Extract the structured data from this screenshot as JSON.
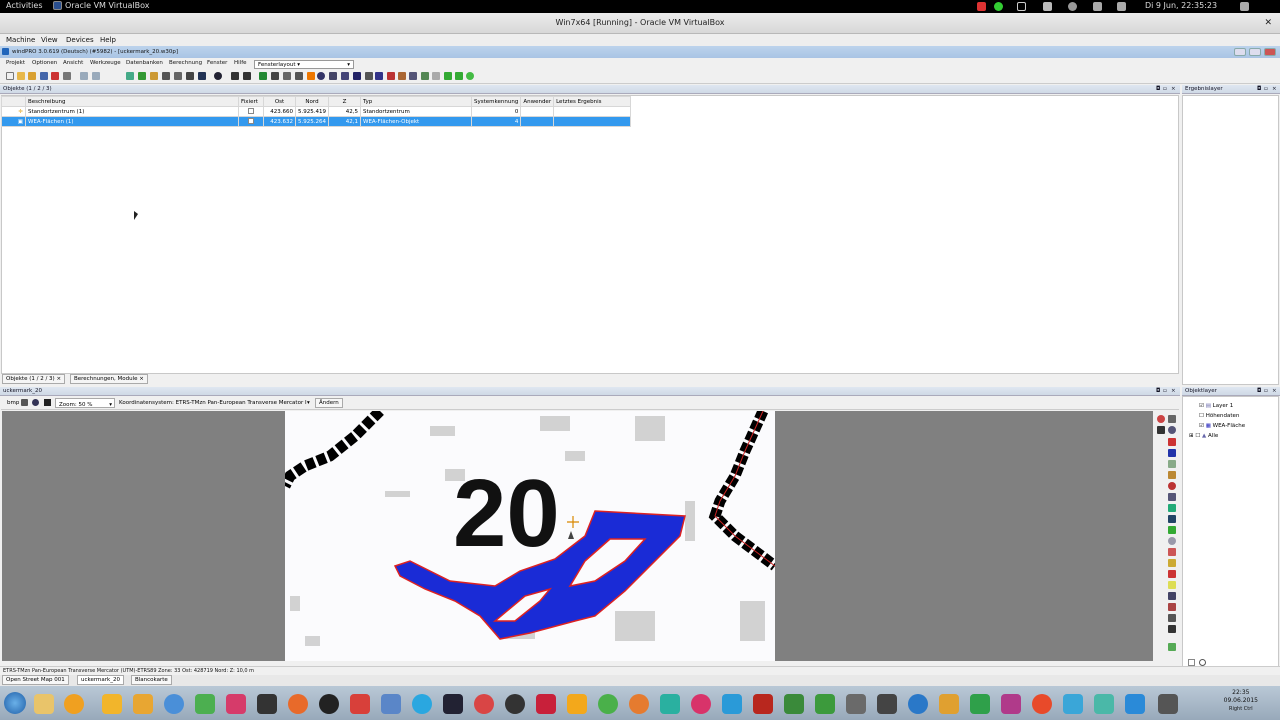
{
  "gnome": {
    "activities": "Activities",
    "app": "Oracle VM VirtualBox",
    "datetime": "Di 9 Jun, 22:35:23"
  },
  "vbox": {
    "title": "Win7x64 [Running] - Oracle VM VirtualBox",
    "menu": [
      "Machine",
      "View",
      "Devices",
      "Help"
    ]
  },
  "windpro": {
    "title": "windPRO 3.0.619 (Deutsch) (#5982) - [uckermark_20.w30p]",
    "menu": [
      "Projekt",
      "Optionen",
      "Ansicht",
      "Werkzeuge",
      "Datenbanken",
      "Berechnung",
      "Fenster",
      "Hilfe"
    ],
    "layout_combo": "Fensterlayout",
    "objects_panel_title": "Objekte (1 / 2 / 3)",
    "results_panel_title": "Ergebnislayer",
    "table": {
      "headers": [
        "Beschreibung",
        "Fixiert",
        "Ost",
        "Nord",
        "Z",
        "Typ",
        "Systemkennung",
        "Anwender",
        "Letztes Ergebnis"
      ],
      "rows": [
        {
          "desc": "Standortzentrum (1)",
          "ost": "423.660",
          "nord": "5.925.419",
          "z": "42,5",
          "typ": "Standortzentrum",
          "sys": "0"
        },
        {
          "desc": "WEA-Flächen (1)",
          "ost": "423.632",
          "nord": "5.925.264",
          "z": "42,1",
          "typ": "WEA-Flächen-Objekt",
          "sys": "4"
        }
      ]
    },
    "bottom_tabs": [
      "Objekte (1 / 2 / 3)",
      "Berechnungen, Module"
    ],
    "map_panel_title": "uckermark_20",
    "map_toolbar": {
      "bmp": "bmp",
      "zoom": "Zoom: 50 %",
      "koord": "Koordinatensystem: ETRS-TMzn Pan-European Transverse Mercator I",
      "aendern": "Ändern"
    },
    "map_label": "20",
    "objlayer_title": "Objektlayer",
    "layers": [
      "Layer 1",
      "Höhendaten",
      "WEA-Fläche",
      "Alle"
    ],
    "status": "ETRS-TMzn Pan-European Transverse Mercator (UTM)-ETRS89 Zone: 33  Ost: 428719  Nord:    Z: 10,0 m",
    "map_tabs": [
      "Open Street Map 001",
      "uckermark_20",
      "Blancokarte"
    ]
  },
  "taskbar": {
    "time": "22:35",
    "date": "09.06.2015",
    "rightctrl": "Right Ctrl"
  }
}
